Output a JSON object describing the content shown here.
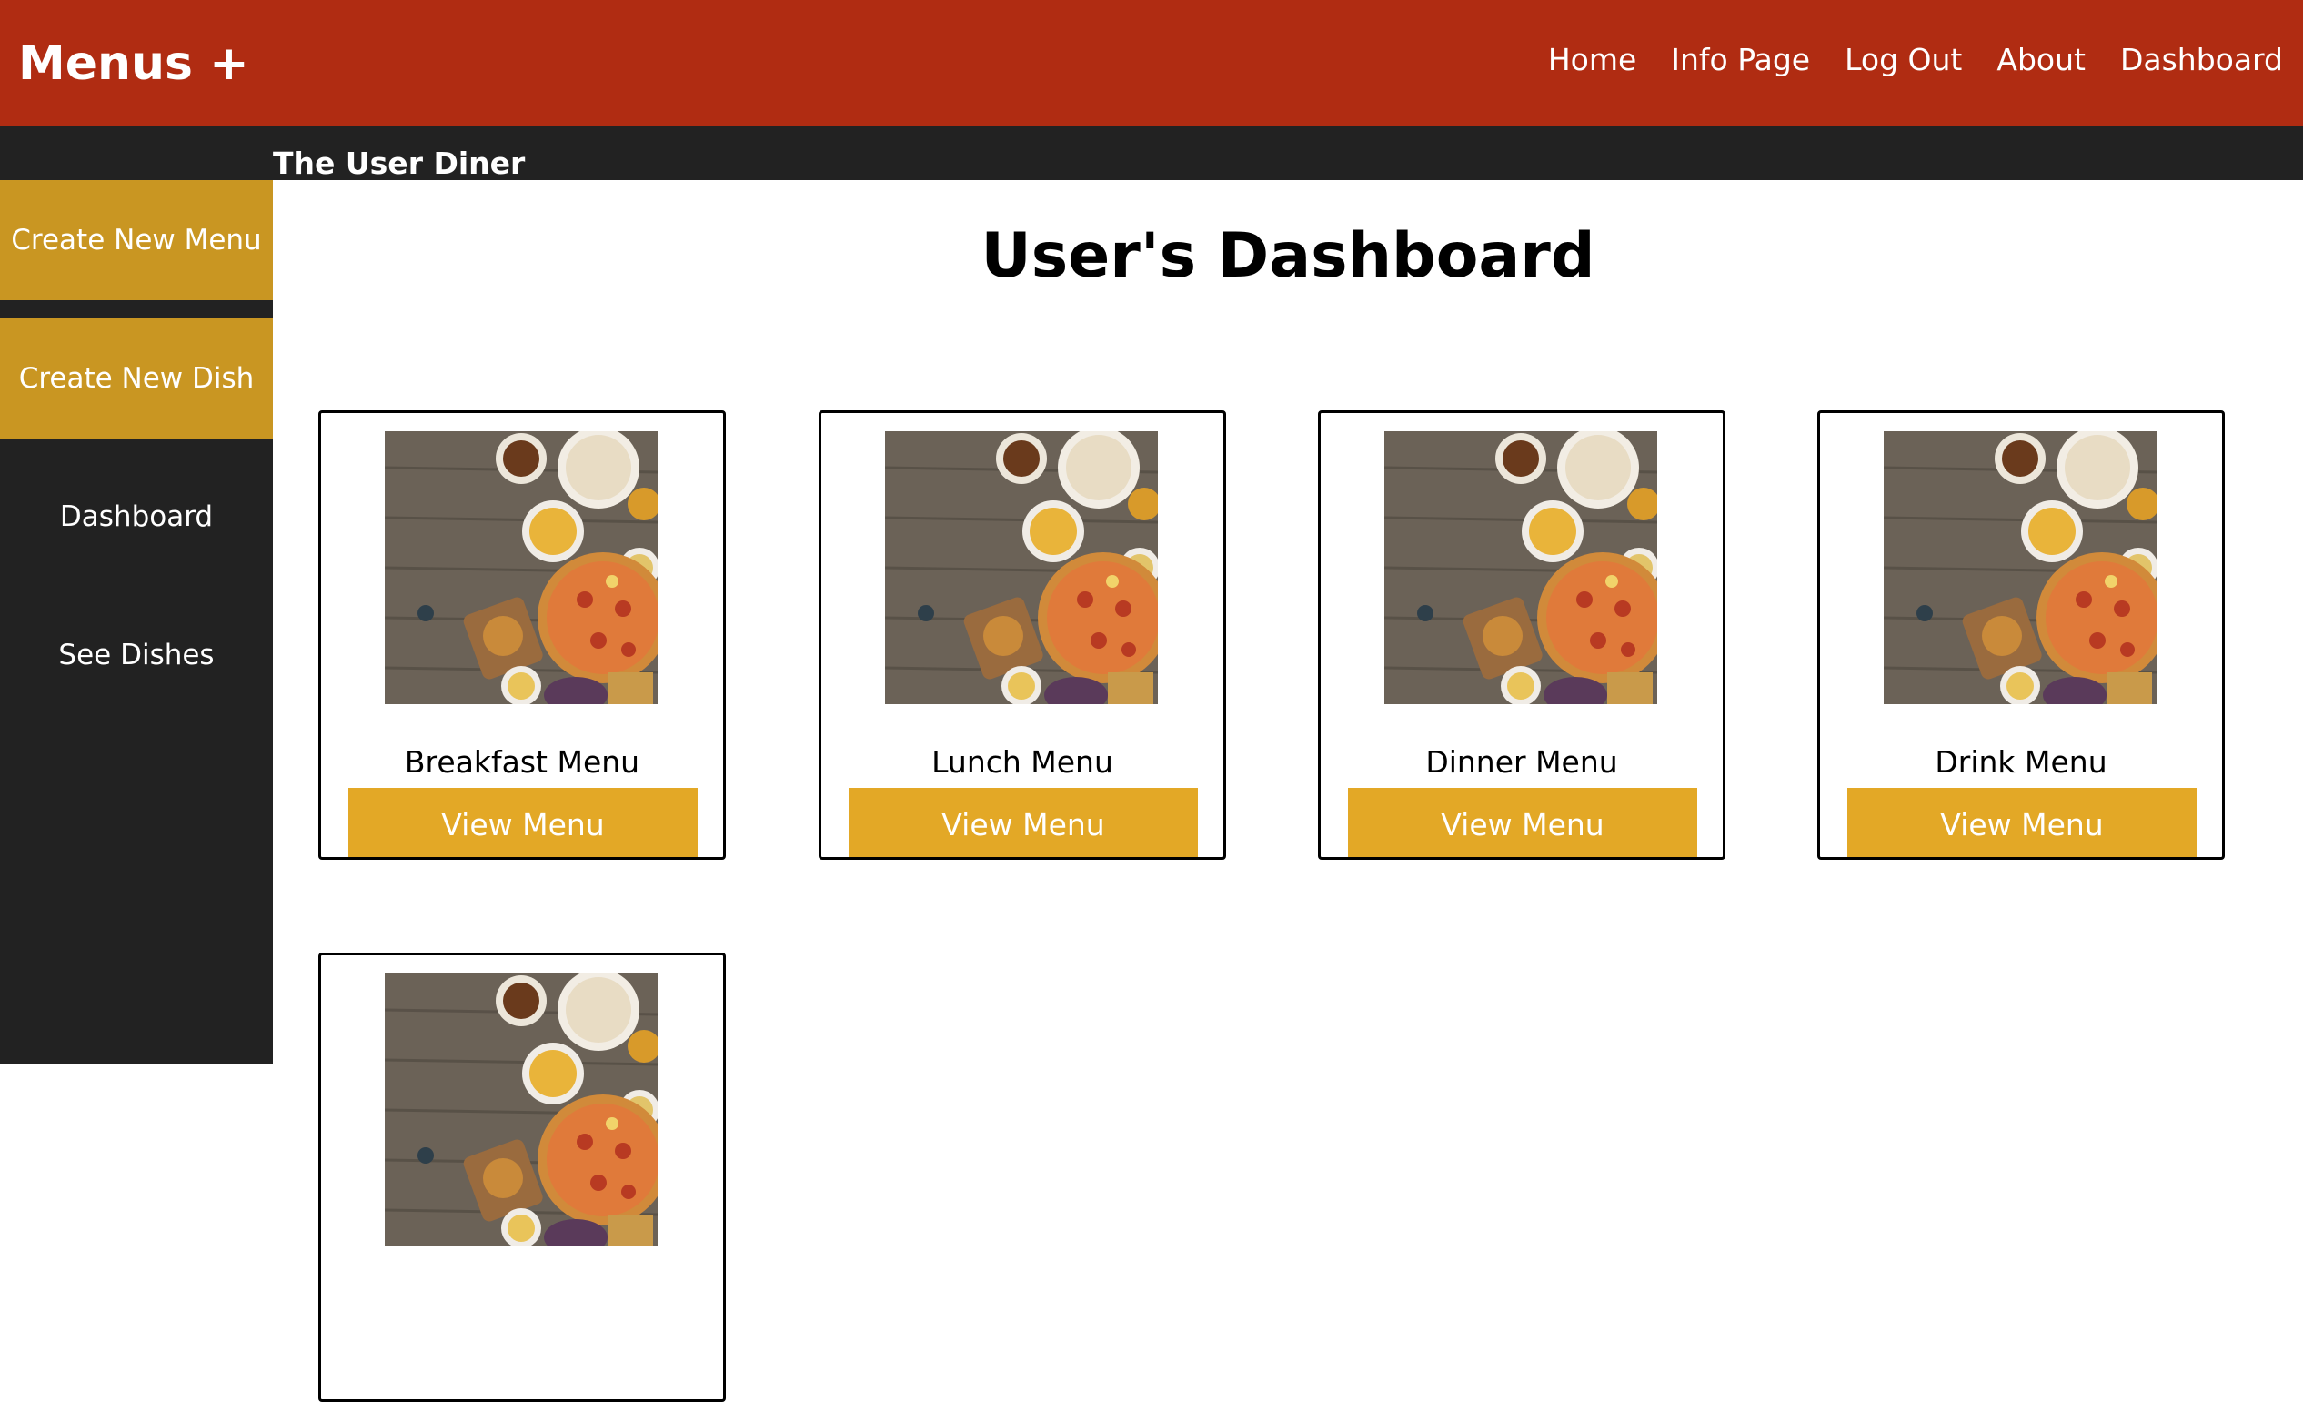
{
  "header": {
    "brand": "Menus +",
    "nav": [
      {
        "label": "Home"
      },
      {
        "label": "Info Page"
      },
      {
        "label": "Log Out"
      },
      {
        "label": "About"
      },
      {
        "label": "Dashboard"
      }
    ]
  },
  "subheader": {
    "diner_name": "The User Diner"
  },
  "sidebar": {
    "items": [
      {
        "label": "Create New Menu"
      },
      {
        "label": "Create New Dish"
      },
      {
        "label": "Dashboard"
      },
      {
        "label": "See Dishes"
      }
    ]
  },
  "main": {
    "title": "User's Dashboard",
    "cards": [
      {
        "title": "Breakfast Menu",
        "button": "View Menu"
      },
      {
        "title": "Lunch Menu",
        "button": "View Menu"
      },
      {
        "title": "Dinner Menu",
        "button": "View Menu"
      },
      {
        "title": "Drink Menu",
        "button": "View Menu"
      },
      {
        "title": "",
        "button": ""
      }
    ]
  },
  "colors": {
    "header_bg": "#b02c12",
    "dark_bg": "#222222",
    "sidebar_accent": "#c99622",
    "button_accent": "#e3a826"
  },
  "icons": {
    "menu_thumbnail": "food-table-photo"
  }
}
